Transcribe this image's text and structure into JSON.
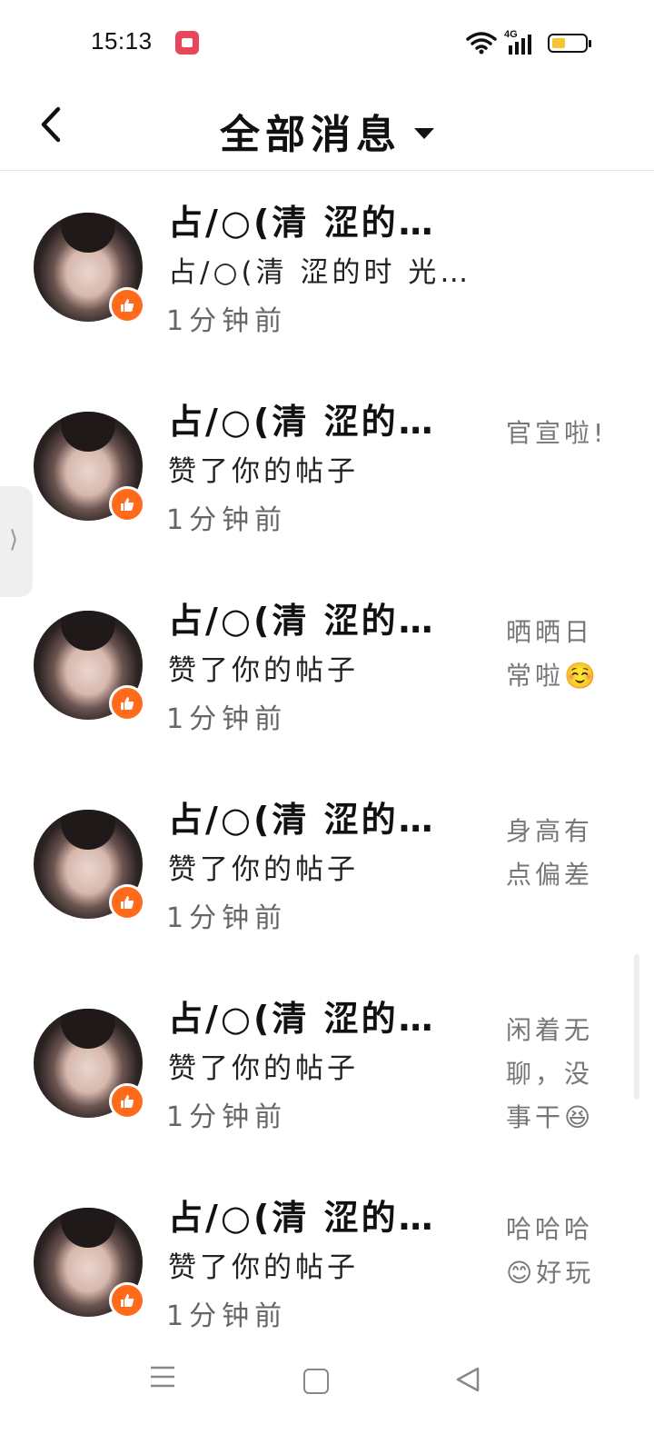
{
  "status_bar": {
    "time": "15:13",
    "network": "4G"
  },
  "header": {
    "title": "全部消息"
  },
  "messages": [
    {
      "name": "占/○(清 涩的…",
      "desc": "占/○(清 涩的时 光…",
      "time": "1分钟前",
      "preview": ""
    },
    {
      "name": "占/○(清 涩的…",
      "desc": "赞了你的帖子",
      "time": "1分钟前",
      "preview": "官宣啦!"
    },
    {
      "name": "占/○(清 涩的…",
      "desc": "赞了你的帖子",
      "time": "1分钟前",
      "preview": "晒晒日常啦☺️"
    },
    {
      "name": "占/○(清 涩的…",
      "desc": "赞了你的帖子",
      "time": "1分钟前",
      "preview": "身高有点偏差"
    },
    {
      "name": "占/○(清 涩的…",
      "desc": "赞了你的帖子",
      "time": "1分钟前",
      "preview": "闲着无聊，没事干😆"
    },
    {
      "name": "占/○(清 涩的…",
      "desc": "赞了你的帖子",
      "time": "1分钟前",
      "preview": "哈哈哈😊好玩"
    }
  ],
  "side_tab": {
    "glyph": "⟩"
  },
  "colors": {
    "like_badge": "#ff6b1a",
    "battery": "#f4c531",
    "rec": "#e8465a"
  }
}
